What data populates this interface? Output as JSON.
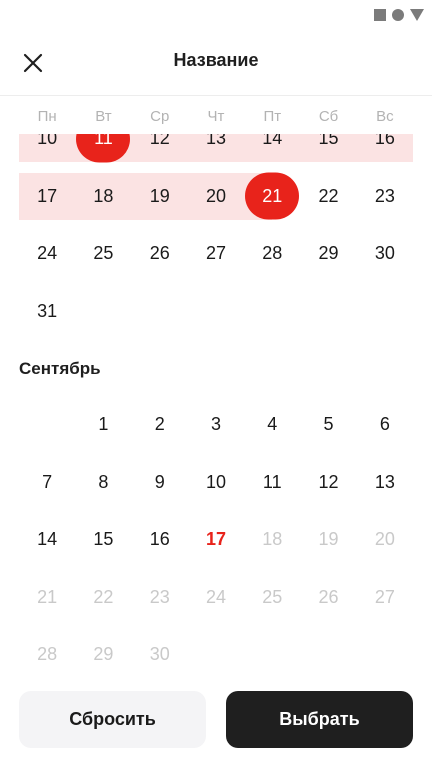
{
  "header": {
    "title": "Название"
  },
  "weekdays": [
    "Пн",
    "Вт",
    "Ср",
    "Чт",
    "Пт",
    "Сб",
    "Вс"
  ],
  "august": {
    "weeks": [
      [
        {
          "d": "10",
          "s": "",
          "band": true
        },
        {
          "d": "11",
          "s": "selected",
          "band": true
        },
        {
          "d": "12",
          "s": "",
          "band": true
        },
        {
          "d": "13",
          "s": "",
          "band": true
        },
        {
          "d": "14",
          "s": "",
          "band": true
        },
        {
          "d": "15",
          "s": "",
          "band": true
        },
        {
          "d": "16",
          "s": "",
          "band": true
        }
      ],
      [
        {
          "d": "17",
          "s": "",
          "band": true
        },
        {
          "d": "18",
          "s": "",
          "band": true
        },
        {
          "d": "19",
          "s": "",
          "band": true
        },
        {
          "d": "20",
          "s": "",
          "band": true
        },
        {
          "d": "21",
          "s": "selected",
          "band": true
        },
        {
          "d": "22",
          "s": "",
          "band": false
        },
        {
          "d": "23",
          "s": "",
          "band": false
        }
      ],
      [
        {
          "d": "24",
          "s": ""
        },
        {
          "d": "25",
          "s": ""
        },
        {
          "d": "26",
          "s": ""
        },
        {
          "d": "27",
          "s": ""
        },
        {
          "d": "28",
          "s": ""
        },
        {
          "d": "29",
          "s": ""
        },
        {
          "d": "30",
          "s": ""
        }
      ],
      [
        {
          "d": "31",
          "s": ""
        },
        {
          "d": "",
          "s": "empty"
        },
        {
          "d": "",
          "s": "empty"
        },
        {
          "d": "",
          "s": "empty"
        },
        {
          "d": "",
          "s": "empty"
        },
        {
          "d": "",
          "s": "empty"
        },
        {
          "d": "",
          "s": "empty"
        }
      ]
    ]
  },
  "september": {
    "title": "Сентябрь",
    "weeks": [
      [
        {
          "d": "",
          "s": "empty"
        },
        {
          "d": "1",
          "s": ""
        },
        {
          "d": "2",
          "s": ""
        },
        {
          "d": "3",
          "s": ""
        },
        {
          "d": "4",
          "s": ""
        },
        {
          "d": "5",
          "s": ""
        },
        {
          "d": "6",
          "s": ""
        }
      ],
      [
        {
          "d": "7",
          "s": ""
        },
        {
          "d": "8",
          "s": ""
        },
        {
          "d": "9",
          "s": ""
        },
        {
          "d": "10",
          "s": ""
        },
        {
          "d": "11",
          "s": ""
        },
        {
          "d": "12",
          "s": ""
        },
        {
          "d": "13",
          "s": ""
        }
      ],
      [
        {
          "d": "14",
          "s": ""
        },
        {
          "d": "15",
          "s": ""
        },
        {
          "d": "16",
          "s": ""
        },
        {
          "d": "17",
          "s": "today"
        },
        {
          "d": "18",
          "s": "disabled"
        },
        {
          "d": "19",
          "s": "disabled"
        },
        {
          "d": "20",
          "s": "disabled"
        }
      ],
      [
        {
          "d": "21",
          "s": "disabled"
        },
        {
          "d": "22",
          "s": "disabled"
        },
        {
          "d": "23",
          "s": "disabled"
        },
        {
          "d": "24",
          "s": "disabled"
        },
        {
          "d": "25",
          "s": "disabled"
        },
        {
          "d": "26",
          "s": "disabled"
        },
        {
          "d": "27",
          "s": "disabled"
        }
      ],
      [
        {
          "d": "28",
          "s": "disabled"
        },
        {
          "d": "29",
          "s": "disabled"
        },
        {
          "d": "30",
          "s": "disabled"
        },
        {
          "d": "",
          "s": "empty"
        },
        {
          "d": "",
          "s": "empty"
        },
        {
          "d": "",
          "s": "empty"
        },
        {
          "d": "",
          "s": "empty"
        }
      ]
    ]
  },
  "footer": {
    "reset_label": "Сбросить",
    "choose_label": "Выбрать"
  },
  "colors": {
    "accent": "#e8231b",
    "range": "#fbe3e3",
    "dark_button": "#1f1f1f",
    "light_button": "#f4f4f6"
  },
  "icons": {
    "close": "close-icon",
    "status": [
      "stop-icon",
      "circle-icon",
      "triangle-down-icon"
    ]
  }
}
